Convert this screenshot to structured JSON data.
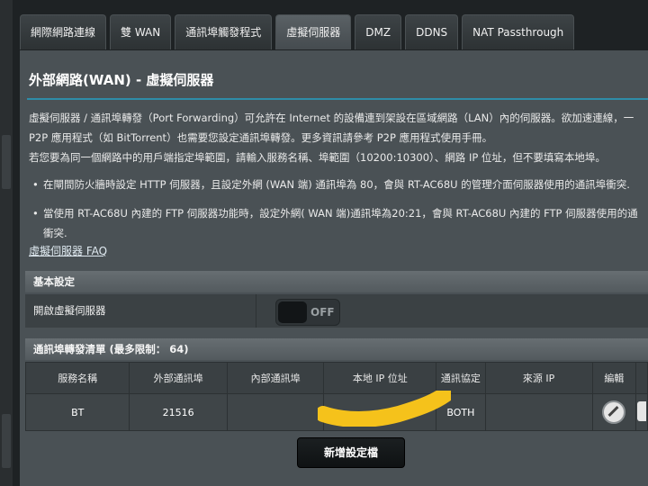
{
  "tabs": [
    {
      "label": "網際網路連線",
      "active": false
    },
    {
      "label": "雙 WAN",
      "active": false
    },
    {
      "label": "通訊埠觸發程式",
      "active": false
    },
    {
      "label": "虛擬伺服器",
      "active": true
    },
    {
      "label": "DMZ",
      "active": false
    },
    {
      "label": "DDNS",
      "active": false
    },
    {
      "label": "NAT Passthrough",
      "active": false
    }
  ],
  "page": {
    "title": "外部網路(WAN) - 虛擬伺服器",
    "desc_line1": "虛擬伺服器 / 通訊埠轉發（Port Forwarding）可允許在 Internet 的設備連到架設在區域網路（LAN）內的伺服器。欲加速連線，一",
    "desc_line2": "P2P 應用程式（如 BitTorrent）也需要您設定通訊埠轉發。更多資訊請參考 P2P 應用程式使用手冊。",
    "desc_line3": "若您要為同一個網路中的用戶端指定埠範圍，請輸入服務名稱、埠範圍（10200:10300）、網路 IP 位址，但不要填寫本地埠。",
    "bullet1": "在閘間防火牆時設定 HTTP 伺服器，且設定外網 (WAN 端) 通訊埠為 80，會與 RT-AC68U 的管理介面伺服器使用的通訊埠衝突.",
    "bullet2_line1": "當使用 RT-AC68U 內建的 FTP 伺服器功能時，設定外網( WAN 端)通訊埠為20:21，會與 RT-AC68U 內建的 FTP 伺服器使用的通",
    "bullet2_line2": "衝突.",
    "faq_link": "虛擬伺服器 FAQ"
  },
  "basic": {
    "header": "基本設定",
    "enable_label": "開啟虛擬伺服器",
    "toggle_text": "OFF",
    "toggle_on": false
  },
  "list": {
    "header": "通訊埠轉發清單 (最多限制： 64)",
    "columns": [
      "服務名稱",
      "外部通訊埠",
      "內部通訊埠",
      "本地 IP 位址",
      "通訊協定",
      "來源 IP",
      "編輯"
    ],
    "rows": [
      {
        "service": "BT",
        "external_port": "21516",
        "internal_port": "",
        "local_ip": "",
        "protocol": "BOTH",
        "source_ip": ""
      }
    ]
  },
  "add_button": "新增設定檔",
  "colors": {
    "accent_line": "#2e8ca8",
    "redaction": "#f5c21b"
  }
}
